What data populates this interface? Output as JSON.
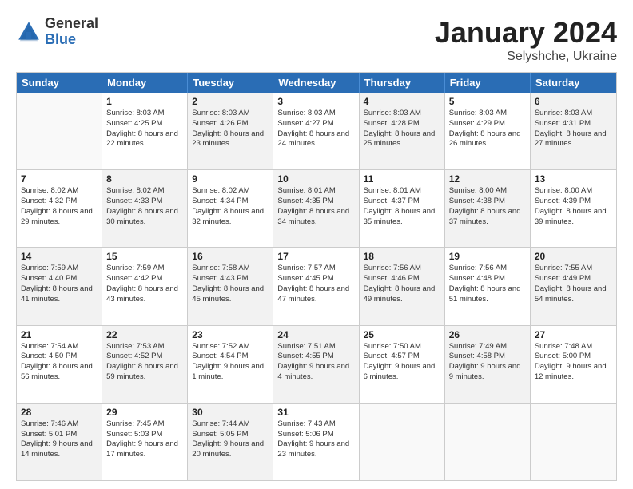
{
  "logo": {
    "general": "General",
    "blue": "Blue"
  },
  "title": "January 2024",
  "subtitle": "Selyshche, Ukraine",
  "days": [
    "Sunday",
    "Monday",
    "Tuesday",
    "Wednesday",
    "Thursday",
    "Friday",
    "Saturday"
  ],
  "weeks": [
    [
      {
        "day": "",
        "sunrise": "",
        "sunset": "",
        "daylight": "",
        "shaded": false,
        "empty": true
      },
      {
        "day": "1",
        "sunrise": "Sunrise: 8:03 AM",
        "sunset": "Sunset: 4:25 PM",
        "daylight": "Daylight: 8 hours and 22 minutes.",
        "shaded": false
      },
      {
        "day": "2",
        "sunrise": "Sunrise: 8:03 AM",
        "sunset": "Sunset: 4:26 PM",
        "daylight": "Daylight: 8 hours and 23 minutes.",
        "shaded": true
      },
      {
        "day": "3",
        "sunrise": "Sunrise: 8:03 AM",
        "sunset": "Sunset: 4:27 PM",
        "daylight": "Daylight: 8 hours and 24 minutes.",
        "shaded": false
      },
      {
        "day": "4",
        "sunrise": "Sunrise: 8:03 AM",
        "sunset": "Sunset: 4:28 PM",
        "daylight": "Daylight: 8 hours and 25 minutes.",
        "shaded": true
      },
      {
        "day": "5",
        "sunrise": "Sunrise: 8:03 AM",
        "sunset": "Sunset: 4:29 PM",
        "daylight": "Daylight: 8 hours and 26 minutes.",
        "shaded": false
      },
      {
        "day": "6",
        "sunrise": "Sunrise: 8:03 AM",
        "sunset": "Sunset: 4:31 PM",
        "daylight": "Daylight: 8 hours and 27 minutes.",
        "shaded": true
      }
    ],
    [
      {
        "day": "7",
        "sunrise": "Sunrise: 8:02 AM",
        "sunset": "Sunset: 4:32 PM",
        "daylight": "Daylight: 8 hours and 29 minutes.",
        "shaded": false
      },
      {
        "day": "8",
        "sunrise": "Sunrise: 8:02 AM",
        "sunset": "Sunset: 4:33 PM",
        "daylight": "Daylight: 8 hours and 30 minutes.",
        "shaded": true
      },
      {
        "day": "9",
        "sunrise": "Sunrise: 8:02 AM",
        "sunset": "Sunset: 4:34 PM",
        "daylight": "Daylight: 8 hours and 32 minutes.",
        "shaded": false
      },
      {
        "day": "10",
        "sunrise": "Sunrise: 8:01 AM",
        "sunset": "Sunset: 4:35 PM",
        "daylight": "Daylight: 8 hours and 34 minutes.",
        "shaded": true
      },
      {
        "day": "11",
        "sunrise": "Sunrise: 8:01 AM",
        "sunset": "Sunset: 4:37 PM",
        "daylight": "Daylight: 8 hours and 35 minutes.",
        "shaded": false
      },
      {
        "day": "12",
        "sunrise": "Sunrise: 8:00 AM",
        "sunset": "Sunset: 4:38 PM",
        "daylight": "Daylight: 8 hours and 37 minutes.",
        "shaded": true
      },
      {
        "day": "13",
        "sunrise": "Sunrise: 8:00 AM",
        "sunset": "Sunset: 4:39 PM",
        "daylight": "Daylight: 8 hours and 39 minutes.",
        "shaded": false
      }
    ],
    [
      {
        "day": "14",
        "sunrise": "Sunrise: 7:59 AM",
        "sunset": "Sunset: 4:40 PM",
        "daylight": "Daylight: 8 hours and 41 minutes.",
        "shaded": true
      },
      {
        "day": "15",
        "sunrise": "Sunrise: 7:59 AM",
        "sunset": "Sunset: 4:42 PM",
        "daylight": "Daylight: 8 hours and 43 minutes.",
        "shaded": false
      },
      {
        "day": "16",
        "sunrise": "Sunrise: 7:58 AM",
        "sunset": "Sunset: 4:43 PM",
        "daylight": "Daylight: 8 hours and 45 minutes.",
        "shaded": true
      },
      {
        "day": "17",
        "sunrise": "Sunrise: 7:57 AM",
        "sunset": "Sunset: 4:45 PM",
        "daylight": "Daylight: 8 hours and 47 minutes.",
        "shaded": false
      },
      {
        "day": "18",
        "sunrise": "Sunrise: 7:56 AM",
        "sunset": "Sunset: 4:46 PM",
        "daylight": "Daylight: 8 hours and 49 minutes.",
        "shaded": true
      },
      {
        "day": "19",
        "sunrise": "Sunrise: 7:56 AM",
        "sunset": "Sunset: 4:48 PM",
        "daylight": "Daylight: 8 hours and 51 minutes.",
        "shaded": false
      },
      {
        "day": "20",
        "sunrise": "Sunrise: 7:55 AM",
        "sunset": "Sunset: 4:49 PM",
        "daylight": "Daylight: 8 hours and 54 minutes.",
        "shaded": true
      }
    ],
    [
      {
        "day": "21",
        "sunrise": "Sunrise: 7:54 AM",
        "sunset": "Sunset: 4:50 PM",
        "daylight": "Daylight: 8 hours and 56 minutes.",
        "shaded": false
      },
      {
        "day": "22",
        "sunrise": "Sunrise: 7:53 AM",
        "sunset": "Sunset: 4:52 PM",
        "daylight": "Daylight: 8 hours and 59 minutes.",
        "shaded": true
      },
      {
        "day": "23",
        "sunrise": "Sunrise: 7:52 AM",
        "sunset": "Sunset: 4:54 PM",
        "daylight": "Daylight: 9 hours and 1 minute.",
        "shaded": false
      },
      {
        "day": "24",
        "sunrise": "Sunrise: 7:51 AM",
        "sunset": "Sunset: 4:55 PM",
        "daylight": "Daylight: 9 hours and 4 minutes.",
        "shaded": true
      },
      {
        "day": "25",
        "sunrise": "Sunrise: 7:50 AM",
        "sunset": "Sunset: 4:57 PM",
        "daylight": "Daylight: 9 hours and 6 minutes.",
        "shaded": false
      },
      {
        "day": "26",
        "sunrise": "Sunrise: 7:49 AM",
        "sunset": "Sunset: 4:58 PM",
        "daylight": "Daylight: 9 hours and 9 minutes.",
        "shaded": true
      },
      {
        "day": "27",
        "sunrise": "Sunrise: 7:48 AM",
        "sunset": "Sunset: 5:00 PM",
        "daylight": "Daylight: 9 hours and 12 minutes.",
        "shaded": false
      }
    ],
    [
      {
        "day": "28",
        "sunrise": "Sunrise: 7:46 AM",
        "sunset": "Sunset: 5:01 PM",
        "daylight": "Daylight: 9 hours and 14 minutes.",
        "shaded": true
      },
      {
        "day": "29",
        "sunrise": "Sunrise: 7:45 AM",
        "sunset": "Sunset: 5:03 PM",
        "daylight": "Daylight: 9 hours and 17 minutes.",
        "shaded": false
      },
      {
        "day": "30",
        "sunrise": "Sunrise: 7:44 AM",
        "sunset": "Sunset: 5:05 PM",
        "daylight": "Daylight: 9 hours and 20 minutes.",
        "shaded": true
      },
      {
        "day": "31",
        "sunrise": "Sunrise: 7:43 AM",
        "sunset": "Sunset: 5:06 PM",
        "daylight": "Daylight: 9 hours and 23 minutes.",
        "shaded": false
      },
      {
        "day": "",
        "sunrise": "",
        "sunset": "",
        "daylight": "",
        "shaded": false,
        "empty": true
      },
      {
        "day": "",
        "sunrise": "",
        "sunset": "",
        "daylight": "",
        "shaded": false,
        "empty": true
      },
      {
        "day": "",
        "sunrise": "",
        "sunset": "",
        "daylight": "",
        "shaded": false,
        "empty": true
      }
    ]
  ]
}
